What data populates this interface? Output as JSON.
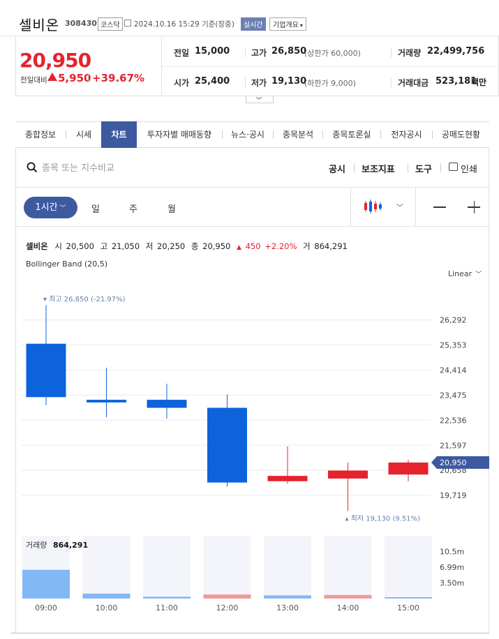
{
  "header": {
    "stock_name": "셀비온",
    "stock_code": "308430",
    "market": "코스닥",
    "datetime": "2024.10.16 15:29 기준(장중)",
    "realtime": "실시간",
    "company_info": "기업개요"
  },
  "price": {
    "current": "20,950",
    "change_label": "전일대비",
    "change_value": "5,950",
    "change_rate": "+39.67%",
    "up_color": "#e5232e",
    "down_color": "#0d63dc"
  },
  "summary": {
    "prev_close_label": "전일",
    "prev_close": "15,000",
    "high_label": "고가",
    "high": "26,850",
    "upper_limit": "(상한가 60,000)",
    "volume_label": "거래량",
    "volume": "22,499,756",
    "open_label": "시가",
    "open": "25,400",
    "low_label": "저가",
    "low": "19,130",
    "lower_limit": "(하한가 9,000)",
    "amount_label": "거래대금",
    "amount": "523,181",
    "amount_unit": "백만"
  },
  "tabs": [
    "종합정보",
    "시세",
    "차트",
    "투자자별 매매동향",
    "뉴스·공시",
    "종목분석",
    "종목토론실",
    "전자공시",
    "공매도현황"
  ],
  "active_tab": "차트",
  "toolbar": {
    "search_placeholder": "종목 또는 지수비교",
    "disclosure": "공시",
    "indicator": "보조지표",
    "tools": "도구",
    "print": "인쇄"
  },
  "periods": {
    "hour": "1시간",
    "day": "일",
    "week": "주",
    "month": "월"
  },
  "info": {
    "name": "셀비온",
    "open_label": "시",
    "open": "20,500",
    "high_label": "고",
    "high": "21,050",
    "low_label": "저",
    "low": "20,250",
    "close_label": "종",
    "close": "20,950",
    "change": "450",
    "rate": "+2.20%",
    "volume_label": "거",
    "volume": "864,291"
  },
  "indicator_label": "Bollinger Band (20,5)",
  "scale_mode": "Linear",
  "chart_data": {
    "type": "candlestick",
    "x": [
      "09:00",
      "10:00",
      "11:00",
      "12:00",
      "13:00",
      "14:00",
      "15:00"
    ],
    "candles": [
      {
        "open": 25400,
        "high": 26850,
        "low": 23100,
        "close": 23400
      },
      {
        "open": 23300,
        "high": 24500,
        "low": 22650,
        "close": 23200
      },
      {
        "open": 23300,
        "high": 23900,
        "low": 22600,
        "close": 23000
      },
      {
        "open": 23000,
        "high": 23500,
        "low": 20050,
        "close": 20200
      },
      {
        "open": 20250,
        "high": 21550,
        "low": 20150,
        "close": 20450
      },
      {
        "open": 20350,
        "high": 20950,
        "low": 19130,
        "close": 20650
      },
      {
        "open": 20500,
        "high": 21050,
        "low": 20250,
        "close": 20950
      }
    ],
    "y_ticks": [
      "26,292",
      "25,353",
      "24,414",
      "23,475",
      "22,536",
      "21,597",
      "20,658",
      "19,719"
    ],
    "y_tick_values": [
      26292,
      25353,
      24414,
      23475,
      22536,
      21597,
      20658,
      19719
    ],
    "ylim": [
      19200,
      27300
    ],
    "max_label": "최고 26,850 (-21.97%)",
    "min_label": "최저 19,130 (9.51%)",
    "current_label": "20,950",
    "current_value": 20950,
    "volume": {
      "label": "거래량",
      "value_label": "864,291",
      "values": [
        6400000,
        1100000,
        400000,
        900000,
        700000,
        800000,
        300000
      ],
      "directions": [
        "down",
        "down",
        "down",
        "up",
        "down",
        "up",
        "down"
      ],
      "y_ticks": [
        "10.5m",
        "6.99m",
        "3.50m"
      ],
      "y_tick_values": [
        10500000,
        6990000,
        3500000
      ],
      "ylim": [
        0,
        14000000
      ]
    }
  }
}
